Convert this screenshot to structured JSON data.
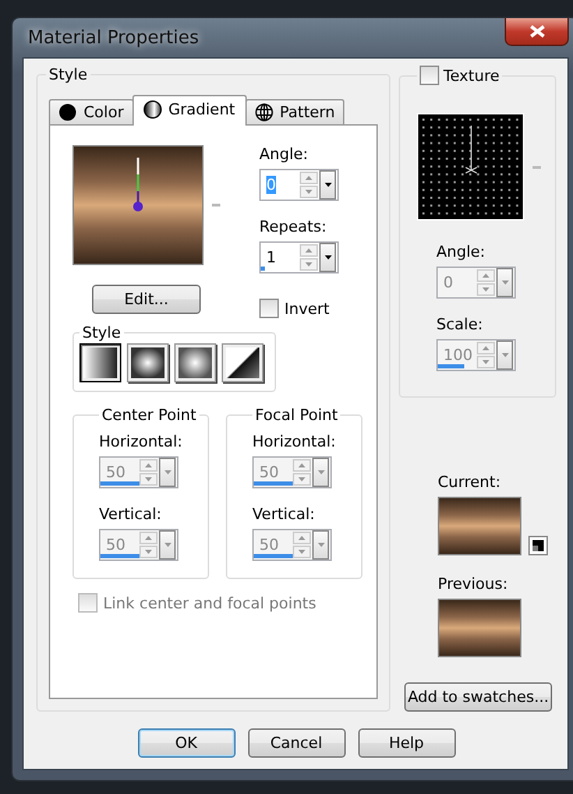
{
  "window": {
    "title": "Material Properties"
  },
  "style_group": {
    "label": "Style",
    "tabs": [
      {
        "label": "Color",
        "kind": "color",
        "selected": false
      },
      {
        "label": "Gradient",
        "kind": "gradient",
        "selected": true
      },
      {
        "label": "Pattern",
        "kind": "pattern",
        "selected": false
      }
    ],
    "angle": {
      "label": "Angle:",
      "value": "0",
      "focused": true,
      "disabled": false
    },
    "repeats": {
      "label": "Repeats:",
      "value": "1",
      "focused": false,
      "disabled": false,
      "level": 0.05
    },
    "edit_button": "Edit...",
    "invert": {
      "label": "Invert",
      "checked": false
    },
    "style": {
      "label": "Style",
      "options": [
        {
          "kind": "linear",
          "selected": true
        },
        {
          "kind": "rectangular",
          "selected": false
        },
        {
          "kind": "sunburst",
          "selected": false
        },
        {
          "kind": "radial",
          "selected": false
        }
      ]
    },
    "points": [
      {
        "label": "Center Point",
        "fields": [
          {
            "label": "Horizontal:",
            "value": "50",
            "focused": false,
            "disabled": true,
            "level": 0.5
          },
          {
            "label": "Vertical:",
            "value": "50",
            "focused": false,
            "disabled": true,
            "level": 0.5
          }
        ]
      },
      {
        "label": "Focal Point",
        "fields": [
          {
            "label": "Horizontal:",
            "value": "50",
            "focused": false,
            "disabled": true,
            "level": 0.5
          },
          {
            "label": "Vertical:",
            "value": "50",
            "focused": false,
            "disabled": true,
            "level": 0.5
          }
        ]
      }
    ],
    "link": {
      "label": "Link center and focal points",
      "checked": false,
      "disabled": true
    }
  },
  "texture": {
    "label": "Texture",
    "checked": false,
    "angle": {
      "label": "Angle:",
      "value": "0",
      "focused": false,
      "disabled": true
    },
    "scale": {
      "label": "Scale:",
      "value": "100",
      "focused": false,
      "disabled": true,
      "level": 0.35
    }
  },
  "current": {
    "label": "Current:"
  },
  "previous": {
    "label": "Previous:"
  },
  "add_button": "Add to swatches...",
  "buttons": [
    {
      "label": "OK",
      "default": true
    },
    {
      "label": "Cancel",
      "default": false
    },
    {
      "label": "Help",
      "default": false
    }
  ]
}
